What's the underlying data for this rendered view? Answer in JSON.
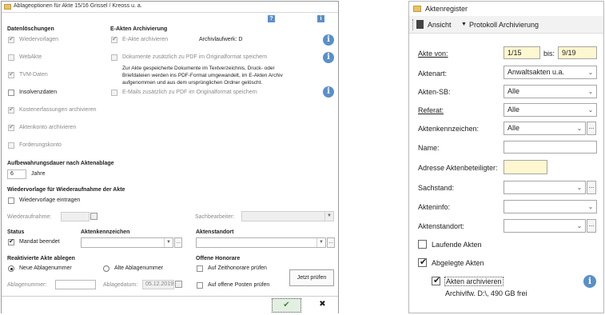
{
  "left": {
    "title": "Ablageoptionen für Akte 15/16 Grissel / Kreoss u. a.",
    "icons": {
      "help": "?",
      "info": "i"
    },
    "datenloeschungen": {
      "heading": "Datenlöschungen",
      "items": [
        {
          "label": "Wiedervorlagen",
          "checked": true,
          "enabled": false
        },
        {
          "label": "WebAkte",
          "checked": false,
          "enabled": false
        },
        {
          "label": "TVM-Daten",
          "checked": true,
          "enabled": false
        },
        {
          "label": "Insolvenzdaten",
          "checked": false,
          "enabled": true
        },
        {
          "label": "Kostenerfassungen archivieren",
          "checked": true,
          "enabled": false
        },
        {
          "label": "Aktenkonto archivieren",
          "checked": true,
          "enabled": false
        },
        {
          "label": "Forderungskonto",
          "checked": false,
          "enabled": false
        }
      ]
    },
    "earchiv": {
      "heading": "E-Akten Archivierung",
      "e_akte_label": "E-Akte archivieren",
      "archivlaufwerk": "Archivlaufwerk: D",
      "dokumente_label": "Dokumente zusätzlich zu PDF im Originalformat speichern",
      "description": "Zur Akte gespeicherte Dokumente im Textverzeichnis, Druck- oder Briefdateien werden ins PDF-Format umgewandelt, im E-Akten Archiv aufgenommen und aus dem ursprünglichen Ordner gelöscht.",
      "emails_label": "E-Mails zusätzlich zu PDF im Originalformat speichern"
    },
    "aufbewahrung": {
      "heading": "Aufbewahrungsdauer nach Aktenablage",
      "value": "6",
      "unit": "Jahre"
    },
    "wiedervorlage": {
      "heading": "Wiedervorlage für Wiederaufnahme der Akte",
      "checkbox_label": "Wiedervorlage eintragen",
      "wiederaufnahme_label": "Wiederaufnahme:",
      "sachbearbeiter_label": "Sachbearbeiter:"
    },
    "status": {
      "heading": "Status",
      "mandat_label": "Mandat beendet",
      "aktenkennzeichen_heading": "Aktenkennzeichen",
      "aktenstandort_heading": "Aktenstandort"
    },
    "reaktiviert": {
      "heading": "Reaktivierte Akte ablegen",
      "neue_label": "Neue Ablagenummer",
      "alte_label": "Alte Ablagenummer",
      "ablagenummer_label": "Ablagenummer:",
      "ablagedatum_label": "Ablagedatum:",
      "ablagedatum_value": "05.12.2019"
    },
    "honorare": {
      "heading": "Offene Honorare",
      "zeithonorare_label": "Auf Zeithonorare prüfen",
      "posten_label": "Auf offene Posten prüfen",
      "button": "Jetzt prüfen"
    },
    "footer": {
      "ok": "✔",
      "cancel": "✖"
    }
  },
  "right": {
    "title": "Aktenregister",
    "toolbar": {
      "ansicht": "Ansicht",
      "protokoll": "Protokoll Archivierung"
    },
    "akte_von_label": "Akte von:",
    "akte_von_value": "1/15",
    "bis_label": "bis:",
    "bis_value": "9/19",
    "aktenart_label": "Aktenart:",
    "aktenart_value": "Anwaltsakten u.a.",
    "akten_sb_label": "Akten-SB:",
    "akten_sb_value": "Alle",
    "referat_label": "Referat:",
    "referat_value": "Alle",
    "aktenkennzeichen_label": "Aktenkennzeichen:",
    "aktenkennzeichen_value": "Alle",
    "name_label": "Name:",
    "adresse_label": "Adresse Aktenbeteiligter:",
    "sachstand_label": "Sachstand:",
    "akteninfo_label": "Akteninfo:",
    "aktenstandort_label": "Aktenstandort:",
    "laufende_label": "Laufende Akten",
    "abgelegte_label": "Abgelegte Akten",
    "archivieren_label": "Akten archivieren",
    "archiv_info": "Archivlfw. D:\\, 490 GB frei"
  }
}
